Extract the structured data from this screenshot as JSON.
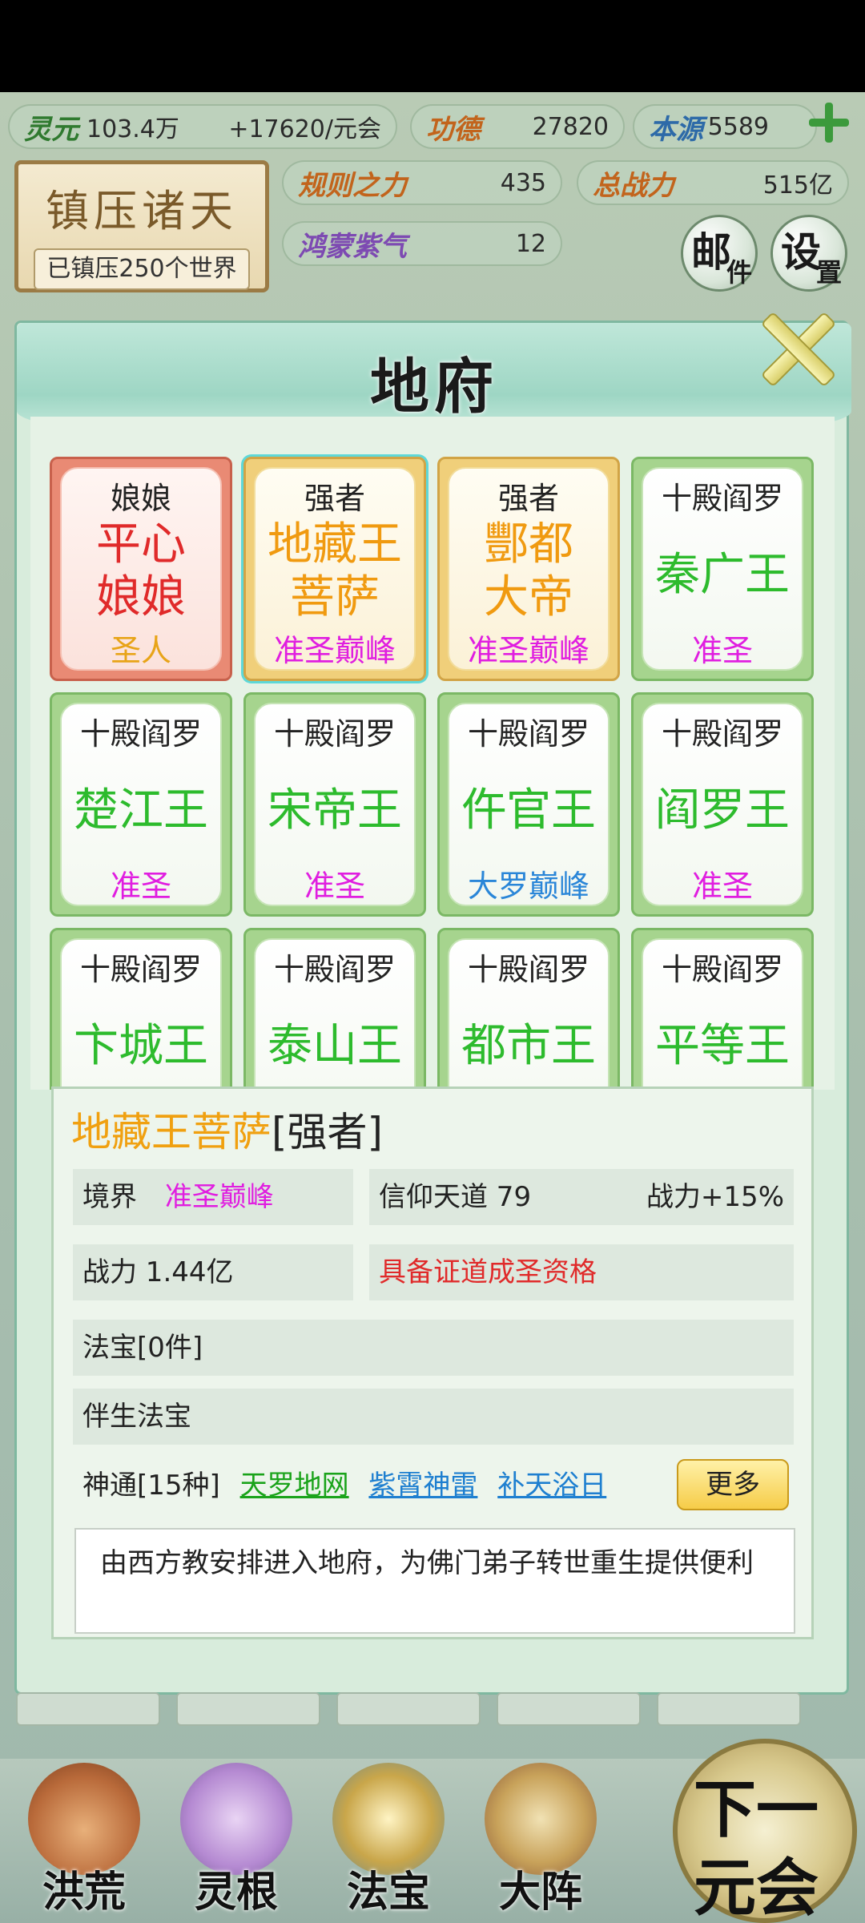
{
  "resources": {
    "lingyuan": {
      "label": "灵元",
      "value": "103.4万",
      "rate": "+17620/元会"
    },
    "gongde": {
      "label": "功德",
      "value": "27820"
    },
    "benyuan": {
      "label": "本源",
      "value": "5589"
    },
    "guize": {
      "label": "规则之力",
      "value": "435"
    },
    "zhanli": {
      "label": "总战力",
      "value": "515亿"
    },
    "hongmeng": {
      "label": "鸿蒙紫气",
      "value": "12"
    }
  },
  "zhenya": {
    "title": "镇压诸天",
    "subtitle": "已镇压250个世界"
  },
  "buttons": {
    "mail": {
      "big": "邮",
      "small": "件"
    },
    "settings": {
      "big": "设",
      "small": "置"
    }
  },
  "panel": {
    "title": "地府"
  },
  "cards": [
    {
      "role": "娘娘",
      "name1": "平心",
      "name2": "娘娘",
      "rank": "圣人"
    },
    {
      "role": "强者",
      "name1": "地藏王",
      "name2": "菩萨",
      "rank": "准圣巅峰"
    },
    {
      "role": "强者",
      "name1": "酆都",
      "name2": "大帝",
      "rank": "准圣巅峰"
    },
    {
      "role": "十殿阎罗",
      "name": "秦广王",
      "rank": "准圣"
    },
    {
      "role": "十殿阎罗",
      "name": "楚江王",
      "rank": "准圣"
    },
    {
      "role": "十殿阎罗",
      "name": "宋帝王",
      "rank": "准圣"
    },
    {
      "role": "十殿阎罗",
      "name": "仵官王",
      "rank": "大罗巅峰"
    },
    {
      "role": "十殿阎罗",
      "name": "阎罗王",
      "rank": "准圣"
    },
    {
      "role": "十殿阎罗",
      "name": "卞城王",
      "rank": ""
    },
    {
      "role": "十殿阎罗",
      "name": "泰山王",
      "rank": ""
    },
    {
      "role": "十殿阎罗",
      "name": "都市王",
      "rank": ""
    },
    {
      "role": "十殿阎罗",
      "name": "平等王",
      "rank": ""
    }
  ],
  "detail": {
    "name": "地藏王菩萨",
    "tag": "[强者]",
    "realm_label": "境界",
    "realm_value": "准圣巅峰",
    "faith": "信仰天道  79",
    "faith_bonus": "战力+15%",
    "power": "战力 1.44亿",
    "qualification": "具备证道成圣资格",
    "treasure": "法宝[0件]",
    "companion": "伴生法宝",
    "skills_label": "神通[15种]",
    "skills": [
      "天罗地网",
      "紫霄神雷",
      "补天浴日"
    ],
    "more": "更多",
    "description": "由西方教安排进入地府，为佛门弟子转世重生提供便利"
  },
  "nav": [
    {
      "label": "洪荒"
    },
    {
      "label": "灵根"
    },
    {
      "label": "法宝"
    },
    {
      "label": "大阵"
    }
  ],
  "next": {
    "line1": "下一",
    "line2": "元会"
  }
}
